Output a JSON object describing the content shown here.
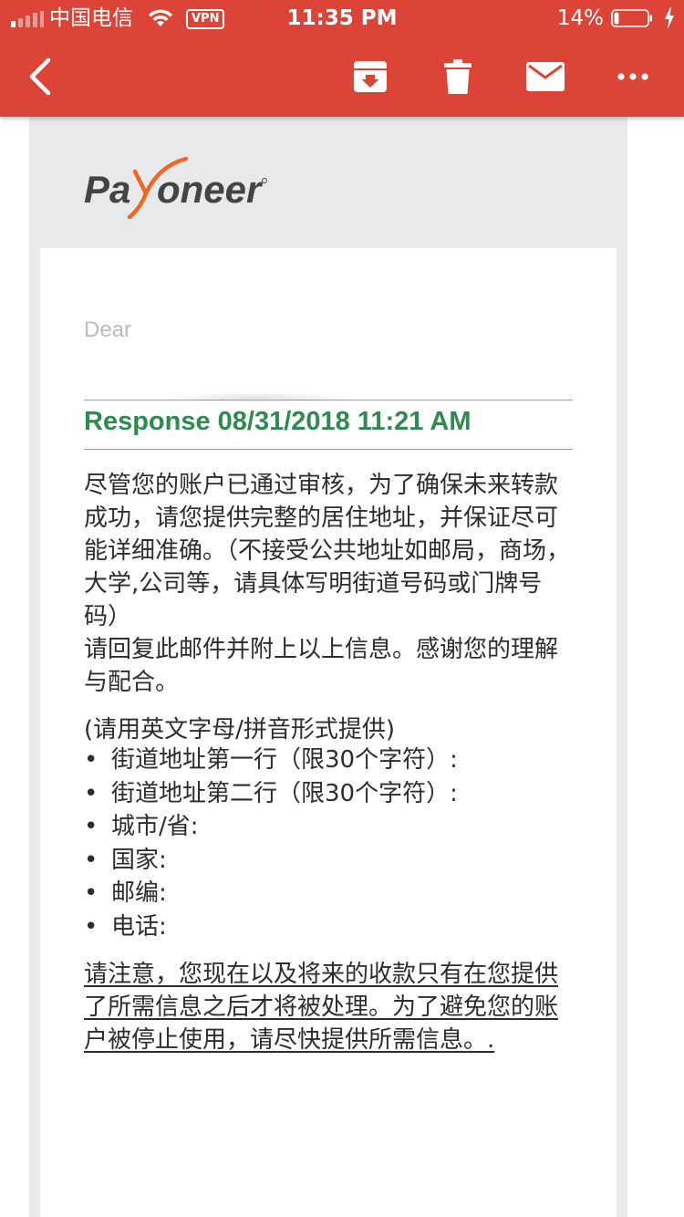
{
  "status_bar": {
    "carrier": "中国电信",
    "vpn": "VPN",
    "time": "11:35 PM",
    "battery_percent": "14%",
    "battery_level": 0.14,
    "signal_bars_filled": 1
  },
  "toolbar": {
    "back_icon": "chevron-left-icon",
    "archive_icon": "archive-icon",
    "delete_icon": "trash-icon",
    "mark_icon": "mail-icon",
    "more_icon": "more-horizontal-icon"
  },
  "colors": {
    "header": "#db4437",
    "response_title": "#2e8b4f",
    "logo_orange": "#f26522",
    "logo_gray": "#444444"
  },
  "email": {
    "logo_text": "Payoneer",
    "greeting": "Dear",
    "response_title": "Response 08/31/2018 11:21 AM",
    "paragraph1": "尽管您的账户已通过审核，为了确保未来转款成功，请您提供完整的居住地址，并保证尽可能详细准确。（不接受公共地址如邮局，商场，大学,公司等，请具体写明街道号码或门牌号码）",
    "paragraph2": "请回复此邮件并附上以上信息。感谢您的理解与配合。",
    "list_intro": "(请用英文字母/拼音形式提供)",
    "bullet_char": "•",
    "fields": [
      "街道地址第一行（限30个字符）:",
      "街道地址第二行（限30个字符）:",
      "城市/省:",
      "国家:",
      "邮编:",
      "电话:"
    ],
    "notice": "请注意，您现在以及将来的收款只有在您提供了所需信息之后才将被处理。为了避免您的账户被停止使用，请尽快提供所需信息。."
  }
}
